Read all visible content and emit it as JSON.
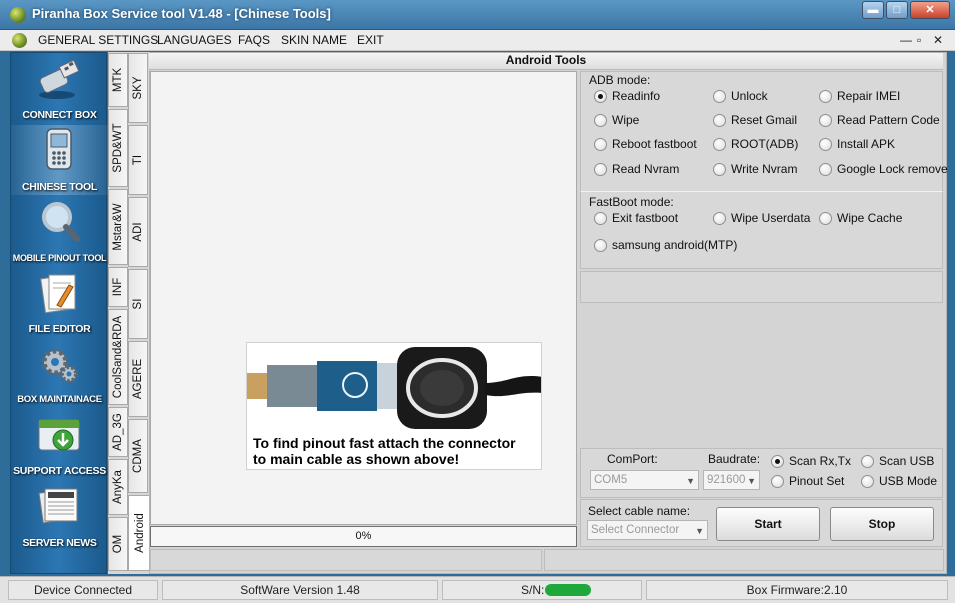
{
  "window": {
    "title": "Piranha Box Service tool V1.48 - [Chinese Tools]"
  },
  "menu": {
    "items": [
      "GENERAL SETTINGS",
      "LANGUAGES",
      "FAQS",
      "SKIN NAME",
      "EXIT"
    ],
    "mdi_controls": [
      "—",
      "▫",
      "✕"
    ]
  },
  "sidebar": {
    "items": [
      {
        "label": "CONNECT BOX",
        "icon": "usb-plug-icon"
      },
      {
        "label": "CHINESE TOOL",
        "icon": "phone-icon"
      },
      {
        "label": "MOBILE PINOUT TOOL",
        "icon": "magnifier-icon"
      },
      {
        "label": "FILE EDITOR",
        "icon": "file-editor-icon"
      },
      {
        "label": "BOX MAINTAINACE",
        "icon": "gears-icon"
      },
      {
        "label": "SUPPORT ACCESS",
        "icon": "support-download-icon"
      },
      {
        "label": "SERVER NEWS",
        "icon": "newspaper-icon"
      }
    ],
    "active_index": 1
  },
  "tabs": {
    "col1": [
      "MTK",
      "SPD&WT",
      "Mstar&W",
      "INF",
      "CoolSand&RDA",
      "AD_3G",
      "AnyKa",
      "OM"
    ],
    "col2": [
      "SKY",
      "TI",
      "ADI",
      "SI",
      "AGERE",
      "CDMA",
      "Android"
    ],
    "active": "Android"
  },
  "panel": {
    "title": "Android Tools",
    "image_caption_line1": "To find pinout fast attach the connector",
    "image_caption_line2": "to main cable as shown above!",
    "progress_text": "0%",
    "progress_value": 0
  },
  "adb": {
    "label": "ADB mode:",
    "options": [
      "Readinfo",
      "Unlock",
      "Repair IMEI",
      "Wipe",
      "Reset Gmail",
      "Read Pattern Code",
      "Reboot fastboot",
      "ROOT(ADB)",
      "Install APK",
      "Read Nvram",
      "Write Nvram",
      "Google Lock remove"
    ],
    "selected": "Readinfo"
  },
  "fastboot": {
    "label": "FastBoot mode:",
    "options": [
      "Exit fastboot",
      "Wipe Userdata",
      "Wipe Cache",
      "samsung android(MTP)"
    ]
  },
  "connection": {
    "comport_label": "ComPort:",
    "comport_value": "COM5",
    "baud_label": "Baudrate:",
    "baud_value": "921600",
    "scan_options": [
      "Scan Rx,Tx",
      "Scan USB",
      "Pinout Set",
      "USB Mode"
    ],
    "scan_selected": "Scan Rx,Tx",
    "cable_label": "Select cable name:",
    "cable_placeholder": "Select Connector",
    "start_label": "Start",
    "stop_label": "Stop"
  },
  "status": {
    "device": "Device Connected",
    "software": "SoftWare Version 1.48",
    "sn_label": "S/N:",
    "firmware": "Box Firmware:2.10"
  },
  "colors": {
    "sidebar_blue": "#2c77b3",
    "sn_redaction": "#1fa83a"
  }
}
